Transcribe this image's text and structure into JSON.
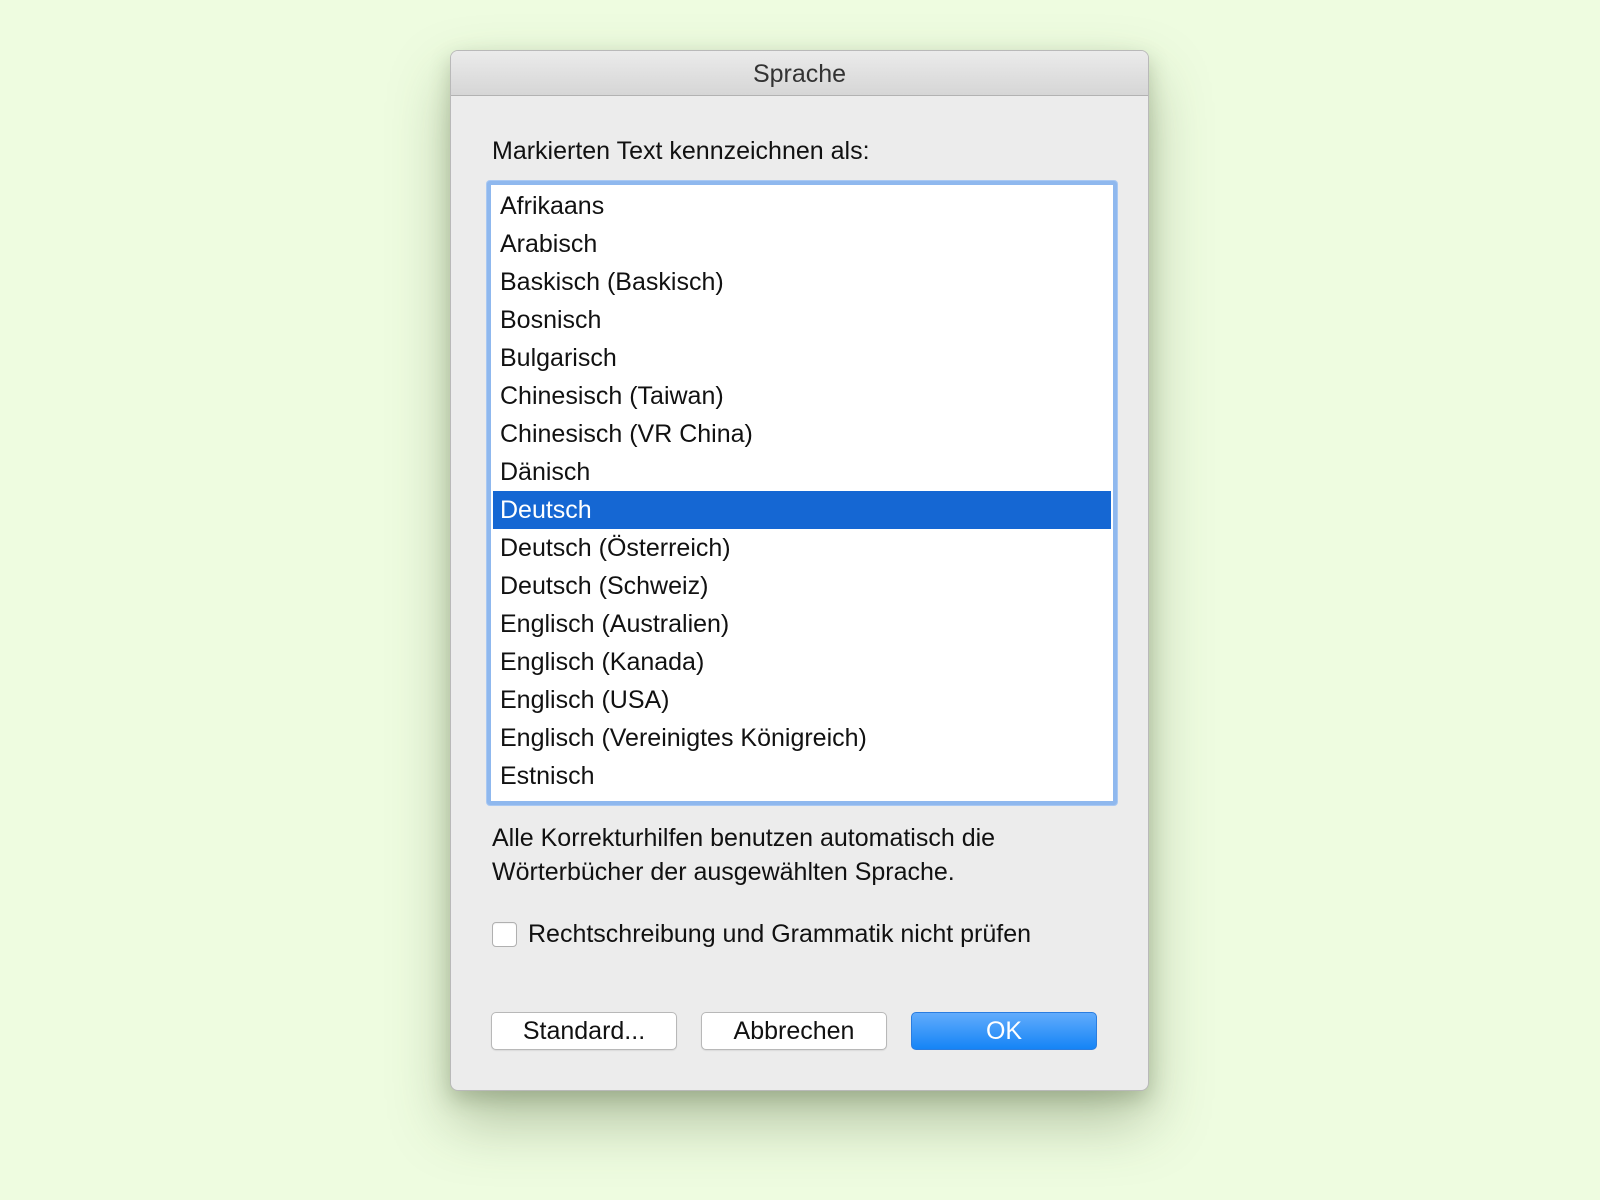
{
  "dialog": {
    "title": "Sprache",
    "prompt_label": "Markierten Text kennzeichnen als:",
    "languages": [
      "Afrikaans",
      "Arabisch",
      "Baskisch (Baskisch)",
      "Bosnisch",
      "Bulgarisch",
      "Chinesisch (Taiwan)",
      "Chinesisch (VR China)",
      "Dänisch",
      "Deutsch",
      "Deutsch (Österreich)",
      "Deutsch (Schweiz)",
      "Englisch (Australien)",
      "Englisch (Kanada)",
      "Englisch (USA)",
      "Englisch (Vereinigtes Königreich)",
      "Estnisch"
    ],
    "selected_language": "Deutsch",
    "info_text_line1": "Alle Korrekturhilfen benutzen automatisch die",
    "info_text_line2": "Wörterbücher der ausgewählten Sprache.",
    "checkbox": {
      "label": "Rechtschreibung und Grammatik nicht prüfen",
      "checked": false
    },
    "buttons": {
      "default_label": "Standard...",
      "cancel_label": "Abbrechen",
      "ok_label": "OK"
    }
  },
  "colors": {
    "background": "#eefce0",
    "selection": "#1567d3",
    "focus_ring": "#8fb8ee",
    "primary_button": "#1584f6"
  }
}
